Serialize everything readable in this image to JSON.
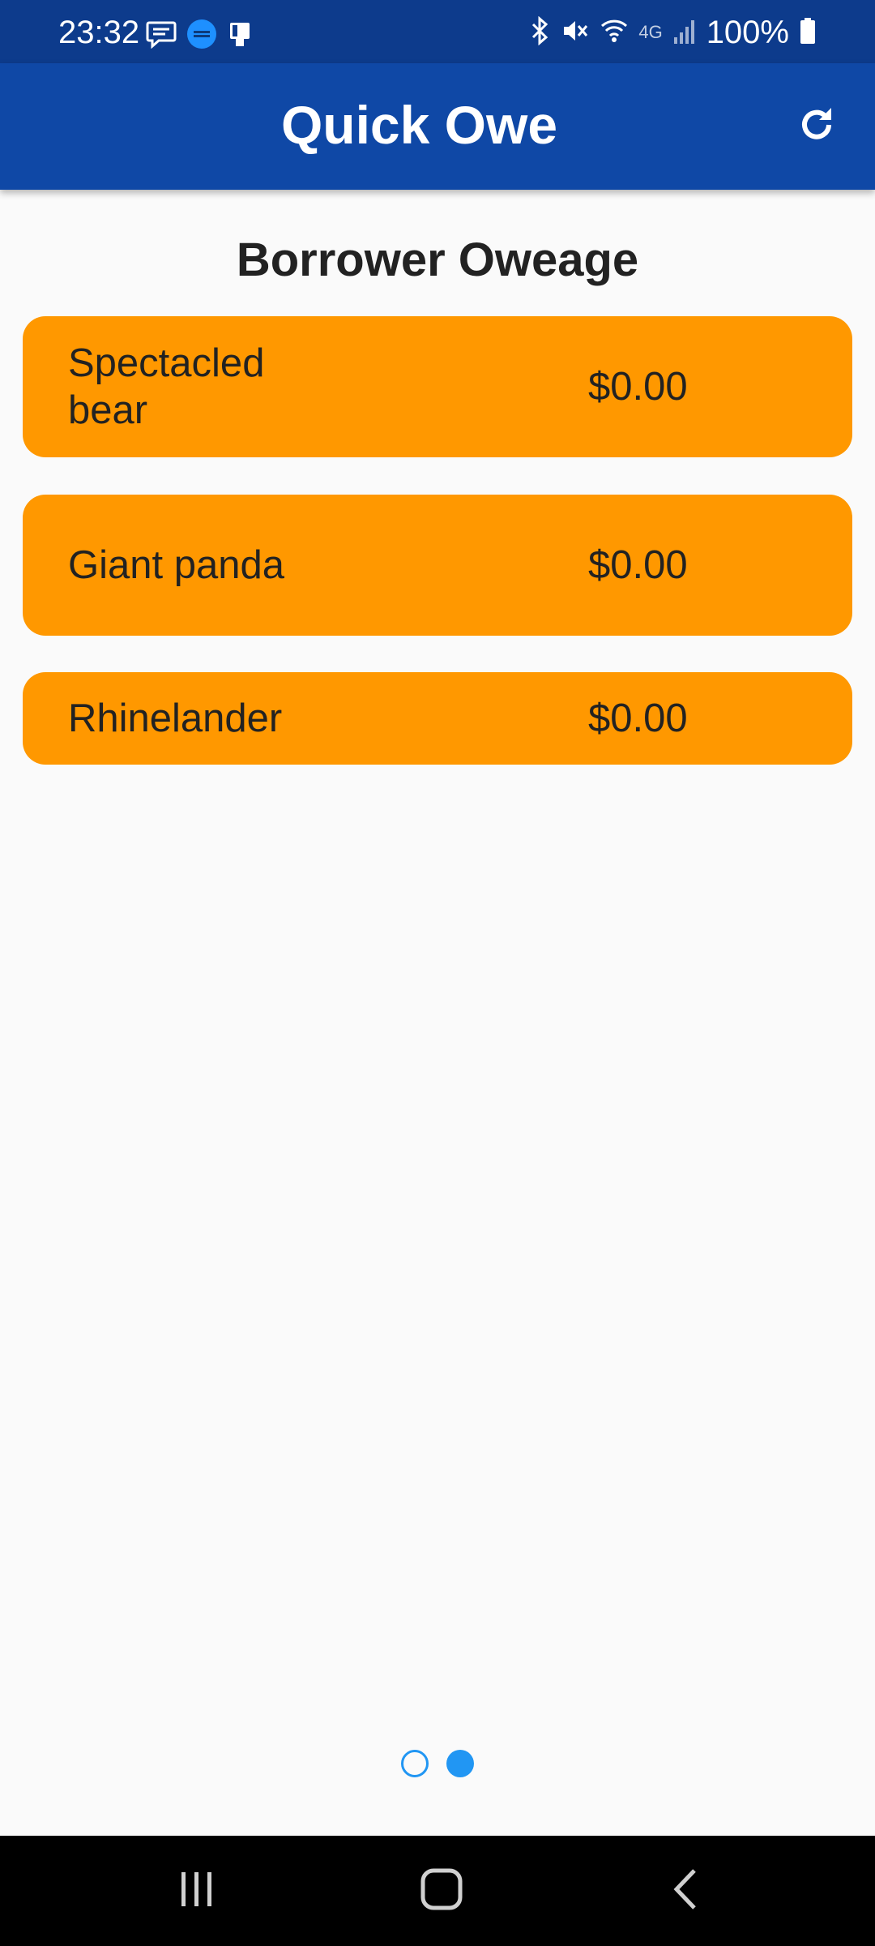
{
  "status_bar": {
    "time": "23:32",
    "battery": "100%",
    "network": "4G",
    "left_icons": [
      "message-icon",
      "usa-today-icon",
      "tablet-icon"
    ],
    "right_icons": [
      "bluetooth-icon",
      "mute-icon",
      "wifi-icon",
      "signal-icon",
      "battery-icon"
    ]
  },
  "app_bar": {
    "title": "Quick Owe",
    "action_icon": "refresh-icon",
    "background": "#0f48a6"
  },
  "page": {
    "heading": "Borrower Oweage"
  },
  "borrowers": [
    {
      "name": "Spectacled bear",
      "amount": "$0.00"
    },
    {
      "name": "Giant panda",
      "amount": "$0.00"
    },
    {
      "name": "Rhinelander",
      "amount": "$0.00"
    }
  ],
  "pager": {
    "total": 2,
    "active_index": 1
  },
  "colors": {
    "card": "#ff9800",
    "accent": "#2196f3",
    "status_bar": "#0d3b8c"
  },
  "nav_bar": {
    "buttons": [
      "recents-icon",
      "home-icon",
      "back-icon"
    ]
  }
}
